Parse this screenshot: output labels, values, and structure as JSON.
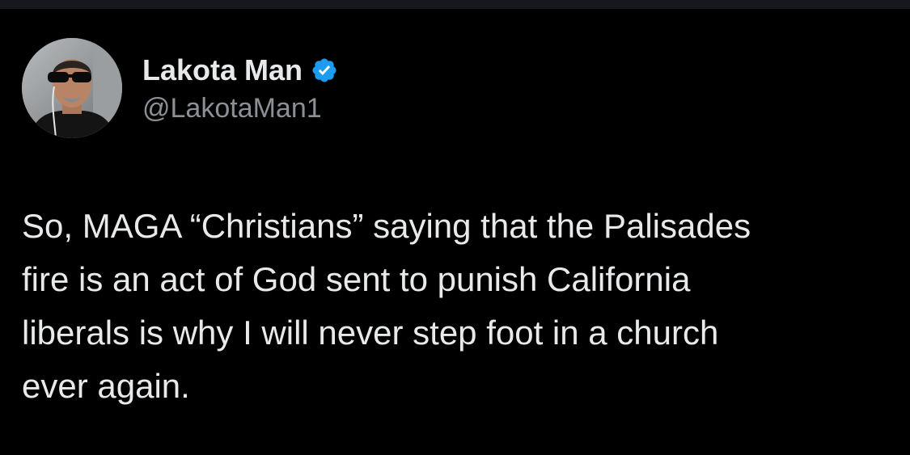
{
  "tweet": {
    "author": {
      "display_name": "Lakota Man",
      "handle": "@LakotaMan1",
      "verified": true,
      "avatar_icon": "profile-photo"
    },
    "text": "So, MAGA “Christians” saying that the Palisades\nfire is an act of God sent to punish California\nliberals is why I will never step foot in a church\never again."
  },
  "colors": {
    "background": "#000000",
    "text_primary": "#e7e9ea",
    "text_secondary": "#8b9096",
    "verified_badge": "#1d9bf0"
  }
}
